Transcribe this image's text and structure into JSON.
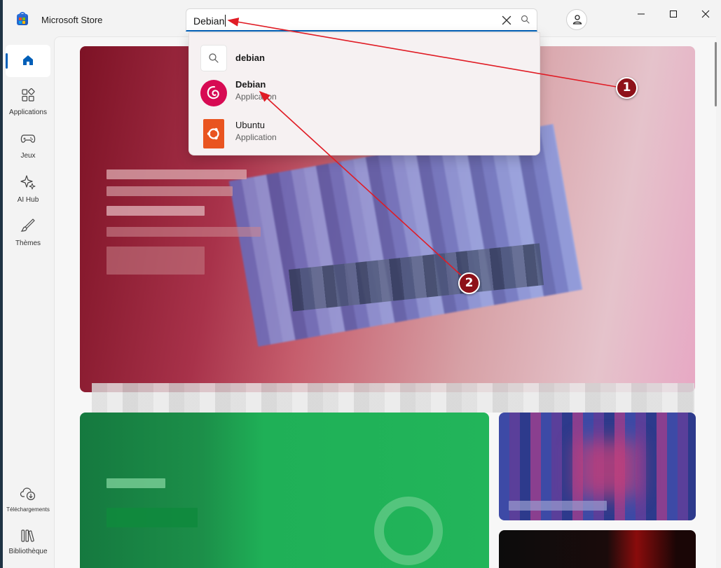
{
  "app": {
    "title": "Microsoft Store",
    "brand_color": "#005fb8"
  },
  "search": {
    "value": "Debian",
    "clear_icon": "close-icon",
    "submit_icon": "search-icon"
  },
  "titlebar": {
    "account_icon": "person-icon",
    "controls": [
      "minimize-icon",
      "maximize-icon",
      "close-icon"
    ]
  },
  "nav": {
    "home": {
      "icon": "home-icon"
    },
    "items": [
      {
        "label": "Applications",
        "icon": "apps-icon"
      },
      {
        "label": "Jeux",
        "icon": "gamepad-icon"
      },
      {
        "label": "AI Hub",
        "icon": "sparkle-icon"
      },
      {
        "label": "Thèmes",
        "icon": "brush-icon"
      }
    ],
    "bottom": [
      {
        "label": "Téléchargements",
        "icon": "cloud-download-icon"
      },
      {
        "label": "Bibliothèque",
        "icon": "library-icon"
      }
    ]
  },
  "suggestions": [
    {
      "title": "debian",
      "subtitle": "",
      "icon": "search-icon"
    },
    {
      "title": "Debian",
      "subtitle": "Application",
      "icon": "debian-logo",
      "color": "#d70a53"
    },
    {
      "title": "Ubuntu",
      "subtitle": "Application",
      "icon": "ubuntu-logo",
      "color": "#e95420"
    }
  ],
  "annotations": [
    {
      "number": "1",
      "color": "#8e1119"
    },
    {
      "number": "2",
      "color": "#8e1119"
    }
  ]
}
